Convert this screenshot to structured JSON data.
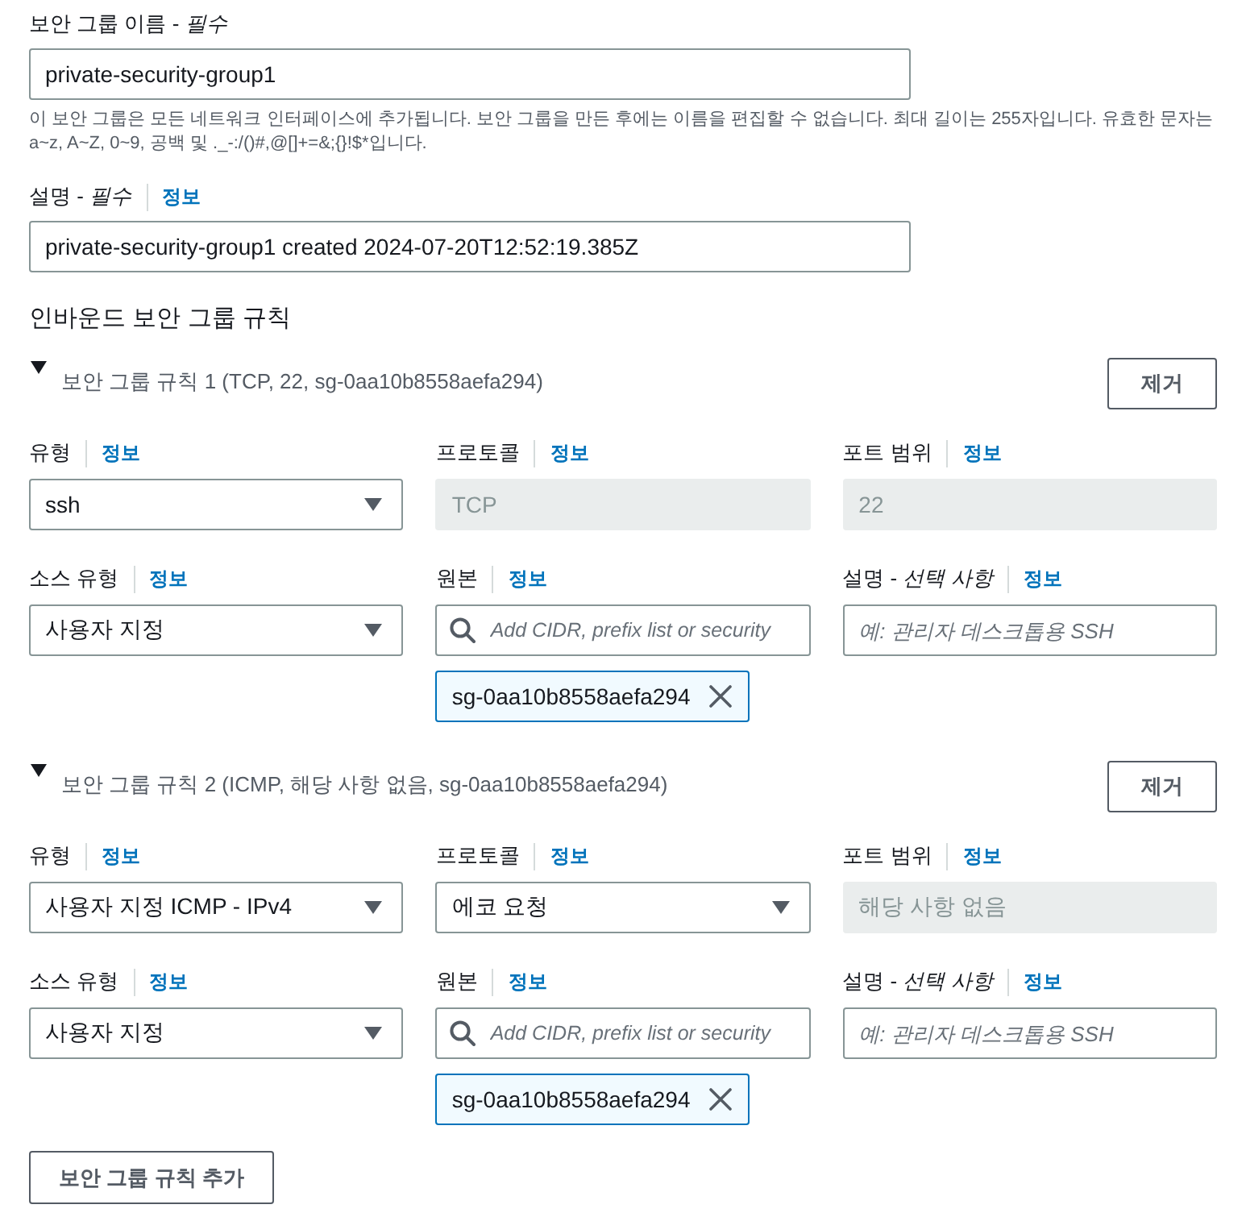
{
  "name_field": {
    "label": "보안 그룹 이름 - *필수*",
    "value": "private-security-group1",
    "help": "이 보안 그룹은 모든 네트워크 인터페이스에 추가됩니다. 보안 그룹을 만든 후에는 이름을 편집할 수 없습니다. 최대 길이는 255자입니다. 유효한 문자는 a~z, A~Z, 0~9, 공백 및 ._-:/()#,@[]+=&;{}!$*입니다."
  },
  "description_field": {
    "label": "설명 - *필수*",
    "info": "정보",
    "value": "private-security-group1 created 2024-07-20T12:52:19.385Z"
  },
  "inbound_rules": {
    "title": "인바운드 보안 그룹 규칙",
    "rules": [
      {
        "summary": "보안 그룹 규칙 1 (TCP, 22, sg-0aa10b8558aefa294)",
        "expanded": true,
        "remove_button": "제거",
        "fields": [
          {
            "kind": "select",
            "label": "유형",
            "info": "정보",
            "value": "ssh",
            "disabled": false
          },
          {
            "kind": "select",
            "label": "프로토콜",
            "info": "정보",
            "value": "TCP",
            "disabled": true
          },
          {
            "kind": "input",
            "label": "포트 범위",
            "info": "정보",
            "value": "22",
            "disabled": true
          },
          {
            "kind": "select",
            "label": "소스 유형",
            "info": "정보",
            "value": "사용자 지정",
            "disabled": false
          },
          {
            "kind": "search",
            "label": "원본",
            "info": "정보",
            "placeholder": "Add CIDR, prefix list or security",
            "disabled": false,
            "tokens": [
              "sg-0aa10b8558aefa294"
            ]
          },
          {
            "kind": "input",
            "label": "설명 - *선택 사항*",
            "info": "정보",
            "placeholder": "예: 관리자 데스크톱용 SSH",
            "disabled": false
          }
        ]
      },
      {
        "summary": "보안 그룹 규칙 2 (ICMP, 해당 사항 없음, sg-0aa10b8558aefa294)",
        "expanded": true,
        "remove_button": "제거",
        "fields": [
          {
            "kind": "select",
            "label": "유형",
            "info": "정보",
            "value": "사용자 지정 ICMP - IPv4",
            "disabled": false
          },
          {
            "kind": "select",
            "label": "프로토콜",
            "info": "정보",
            "value": "에코 요청",
            "disabled": false
          },
          {
            "kind": "input",
            "label": "포트 범위",
            "info": "정보",
            "value": "해당 사항 없음",
            "disabled": true
          },
          {
            "kind": "select",
            "label": "소스 유형",
            "info": "정보",
            "value": "사용자 지정",
            "disabled": false
          },
          {
            "kind": "search",
            "label": "원본",
            "info": "정보",
            "placeholder": "Add CIDR, prefix list or security",
            "disabled": false,
            "tokens": [
              "sg-0aa10b8558aefa294"
            ]
          },
          {
            "kind": "input",
            "label": "설명 - *선택 사항*",
            "info": "정보",
            "placeholder": "예: 관리자 데스크톱용 SSH",
            "disabled": false
          }
        ]
      }
    ]
  },
  "add_rule_button": "보안 그룹 규칙 추가"
}
